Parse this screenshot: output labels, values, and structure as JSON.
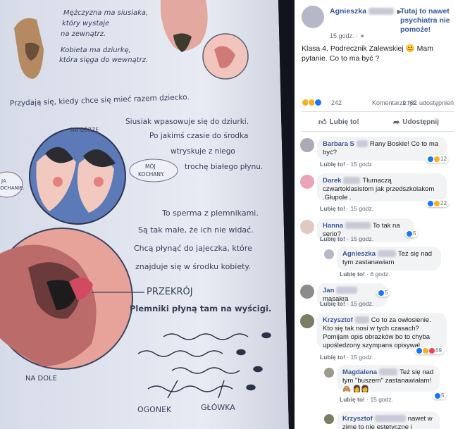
{
  "photo": {
    "texts": {
      "intro1": "Mężczyzna ma siusiaka,",
      "intro2": "który wystaje",
      "intro3": "na zewnątrz.",
      "intro4": "Kobieta ma dziurkę,",
      "intro5": "która sięga do wewnątrz.",
      "line1": "Przydają się, kiedy chce się mieć razem dziecko.",
      "p1": "Siusiak wpasowuje się do dziurki.",
      "p2": "Po jakimś czasie do środka",
      "p3": "wtryskuje z niego",
      "p4": "trochę białego płynu.",
      "top_label": "NA GÓRZE",
      "moj": "MÓJ",
      "kochany": "KOCHANY.",
      "bubble_left1": "JA",
      "bubble_left2": "KOCHANIE.",
      "s1": "To sperma z plemnikami.",
      "s2": "Są tak małe, że ich nie widać.",
      "s3": "Chcą płynąć do jajeczka, które",
      "s4": "znajduje się w środku kobiety.",
      "przekroj": "PRZEKRÓJ",
      "plemniki": "Plemniki płyną tam na wyścigi.",
      "na_dole": "NA DOLE",
      "ogonek": "OGONEK",
      "glowka": "GŁÓWKA"
    }
  },
  "post": {
    "author": "Agnieszka",
    "arrow": "▶",
    "target": "Tutaj to nawet psychiatra nie pomoże!",
    "time": "15 godz. · ",
    "globe_icon": "globe-icon",
    "text": "Klasa 4. Podrecznik Zalewskiej 😊 Mam pytanie. Co to ma być ?",
    "reaction_count": "242",
    "comments_count": "Komentarze: 62",
    "shares_count": "1 tys. udostępnień",
    "like_label": "Lubię to!",
    "share_label": "Udostępnij"
  },
  "comments": [
    {
      "name": "Barbara S",
      "text": "Rany Boskie! Co to ma być?",
      "meta_like": "Lubię to!",
      "meta_time": " · 15 godz.",
      "count": "12"
    },
    {
      "name": "Darek",
      "text": "Tłumaczą czwartoklasistom jak przedszkolakom .Głupole .",
      "meta_like": "Lubię to!",
      "meta_time": " · 15 godz.",
      "count": "22"
    },
    {
      "name": "Hanna",
      "text": "To tak na serio?",
      "meta_like": "Lubię to!",
      "meta_time": " · 15 godz.",
      "count": "5"
    },
    {
      "name": "Agnieszka",
      "text": "Też się nad tym zastanawiam",
      "meta_like": "Lubię to!",
      "meta_time": " · 6 godz."
    },
    {
      "name": "Jan",
      "text": "masakra",
      "meta_like": "Lubię to!",
      "meta_time": " · 15 godz.",
      "count": "5"
    },
    {
      "name": "Krzysztof",
      "text": "Co to za owłosienie. Kto się tak nosi w tych czasach? Pomijam opis obrazków bo to chyba upośledzony szympans opisywał",
      "meta_like": "Lubię to!",
      "meta_time": " · 15 godz.",
      "count": "69"
    },
    {
      "name": "Magdalena",
      "text": "Też się nad tym \"buszem\" zastanawiałam! 🙈 👩👩",
      "meta_like": "Lubię to!",
      "meta_time": " · 15 godz.",
      "count": "5"
    },
    {
      "name": "Krzysztof",
      "text": "nawet w zimę to nie estetyczne i"
    }
  ],
  "colors": {
    "link": "#385898",
    "bubble": "#f2f3f5",
    "like_blue": "#1877f2",
    "love_red": "#f33e58",
    "haha_yellow": "#f7b125"
  }
}
